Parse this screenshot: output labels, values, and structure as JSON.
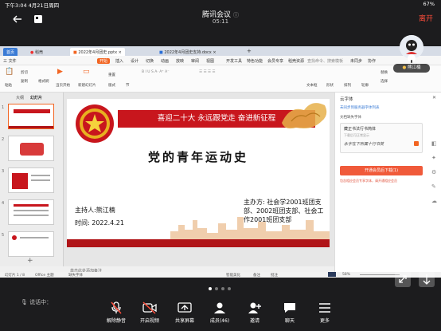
{
  "status_bar": {
    "left": "下午3:04  4月21日周四",
    "right": "67%"
  },
  "meeting": {
    "title": "腾讯会议",
    "time": "05:11",
    "leave_label": "离开"
  },
  "share": {
    "tabs": [
      "首页",
      "稻壳",
      "2022年4月团史.pptx",
      "2022年4月团史支持.docx"
    ],
    "menu": [
      "三 文件",
      "开始",
      "插入",
      "设计",
      "切换",
      "动画",
      "放映",
      "审阅",
      "视图",
      "开发工具",
      "特色功能",
      "会员专享",
      "稻壳资源",
      "查找命令、搜索模板"
    ],
    "right_menu": [
      "未同步",
      "协作",
      "分享"
    ],
    "ribbon": [
      "粘贴",
      "剪切",
      "复制",
      "格式刷",
      "当页开始",
      "新建幻灯片",
      "版式",
      "节",
      "重置",
      "文本框",
      "形状",
      "排列",
      "轮廓",
      "替换",
      "选择"
    ],
    "left_tabs": [
      "大纲",
      "幻灯片"
    ],
    "thumb_nums": [
      "1",
      "2",
      "3",
      "4",
      "5"
    ],
    "slide": {
      "banner": "喜迎二十大 永远跟党走 奋进新征程",
      "title": "党的青年运动史",
      "presenter": "主持人:熊江楠",
      "date": "时间:  2022.4.21",
      "organizer": "主办方: 社会学2001班团支部、2002班团支部、社会工作2001班团支部"
    },
    "notes_placeholder": "单击此处添加备注",
    "right_panel": {
      "header": "云字体",
      "line1": "未同步到服务器字体列表",
      "label": "文档缺失字体",
      "font_name": "藏正书法行书简体",
      "hint": "下载后可正常显示",
      "preview": "永字在下所属十行书英",
      "button": "开通会员后下载(1)",
      "footer": "包含相应会员专享字体，请开通相应会员"
    },
    "status_bottom": {
      "left": "幻灯片 1 / 8",
      "theme": "Office 主题",
      "font_missing": "缺失字体",
      "smart": "智能美化",
      "notes": "备注",
      "comments": "批注",
      "zoom": "58%"
    },
    "avatar_name": "熊江楠"
  },
  "speaker": "说话中：",
  "toolbar": [
    {
      "label": "解除静音",
      "icon": "mic-muted-icon"
    },
    {
      "label": "开启视频",
      "icon": "video-off-icon"
    },
    {
      "label": "共享屏幕",
      "icon": "share-screen-icon"
    },
    {
      "label": "成员(46)",
      "icon": "members-icon"
    },
    {
      "label": "邀请",
      "icon": "invite-icon"
    },
    {
      "label": "聊天",
      "icon": "chat-icon"
    },
    {
      "label": "更多",
      "icon": "more-icon"
    }
  ],
  "colors": {
    "accent_red": "#c8161d",
    "leave_red": "#ff4d3a",
    "wps_orange": "#f26522",
    "background": "#1c1c1e"
  }
}
